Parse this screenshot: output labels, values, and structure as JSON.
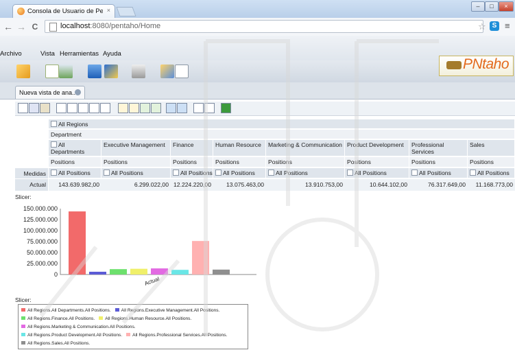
{
  "browser": {
    "tab_title": "Consola de Usuario de Pen",
    "tab_close": "×",
    "window_buttons": [
      "–",
      "□",
      "×"
    ],
    "nav": {
      "back": "←",
      "forward": "→",
      "reload": "C"
    },
    "url_host": "localhost",
    "url_rest": ":8080/pentaho/Home",
    "bookmark_icon": "☆",
    "extension_label": "S",
    "menu_icon": "≡"
  },
  "app": {
    "menu": [
      "Archivo",
      "Vista",
      "Herramientas",
      "Ayuda"
    ],
    "logo_text": "PNtaho",
    "doc_tab": "Nueva vista de ana..."
  },
  "colors": {
    "accent_orange": "#e36a1d",
    "header_bg": "#dfe5ec",
    "cell_bg": "#eef2f6"
  },
  "pivot": {
    "regions": "All Regions",
    "department_label": "Department",
    "columns": [
      {
        "dept": "All Departments",
        "measure_hdr": "Positions",
        "member": "All Positions",
        "value": "143.639.982,00"
      },
      {
        "dept": "Executive Management",
        "measure_hdr": "Positions",
        "member": "All Positions",
        "value": "6.299.022,00"
      },
      {
        "dept": "Finance",
        "measure_hdr": "Positions",
        "member": "All Positions",
        "value": "12.224.220,00"
      },
      {
        "dept": "Human Resource",
        "measure_hdr": "Positions",
        "member": "All Positions",
        "value": "13.075.463,00"
      },
      {
        "dept": "Marketing & Communication",
        "measure_hdr": "Positions",
        "member": "All Positions",
        "value": "13.910.753,00"
      },
      {
        "dept": "Product Development",
        "measure_hdr": "Positions",
        "member": "All Positions",
        "value": "10.644.102,00"
      },
      {
        "dept": "Professional Services",
        "measure_hdr": "Positions",
        "member": "All Positions",
        "value": "76.317.649,00"
      },
      {
        "dept": "Sales",
        "measure_hdr": "Positions",
        "member": "All Positions",
        "value": "11.168.773,00"
      }
    ],
    "measures_label": "Medidas",
    "row_label": "Actual"
  },
  "slicer_label": "Slicer:",
  "slicer_label2": "Slicer:",
  "chart_data": {
    "type": "bar",
    "categories": [
      "Actual"
    ],
    "ylim": [
      0,
      150000000
    ],
    "yticks": [
      "0",
      "25.000.000",
      "50.000.000",
      "75.000.000",
      "100.000.000",
      "125.000.000",
      "150.000.000"
    ],
    "xlabel": "Actual",
    "series": [
      {
        "name": "All Regions.All Departments.All Positions.",
        "value": 143639982,
        "color": "#f26a6a"
      },
      {
        "name": "All Regions.Executive Management.All Positions.",
        "value": 6299022,
        "color": "#5b5bd6"
      },
      {
        "name": "All Regions.Finance.All Positions.",
        "value": 12224220,
        "color": "#6de06d"
      },
      {
        "name": "All Regions.Human Resource.All Positions.",
        "value": 13075463,
        "color": "#f0f06a"
      },
      {
        "name": "All Regions.Marketing & Communication.All Positions.",
        "value": 13910753,
        "color": "#e26ae2"
      },
      {
        "name": "All Regions.Product Development.All Positions.",
        "value": 10644102,
        "color": "#6ae6e6"
      },
      {
        "name": "All Regions.Professional Services.All Positions.",
        "value": 76317649,
        "color": "#ffb1b1"
      },
      {
        "name": "All Regions.Sales.All Positions.",
        "value": 11168773,
        "color": "#8f8f8f"
      }
    ]
  }
}
